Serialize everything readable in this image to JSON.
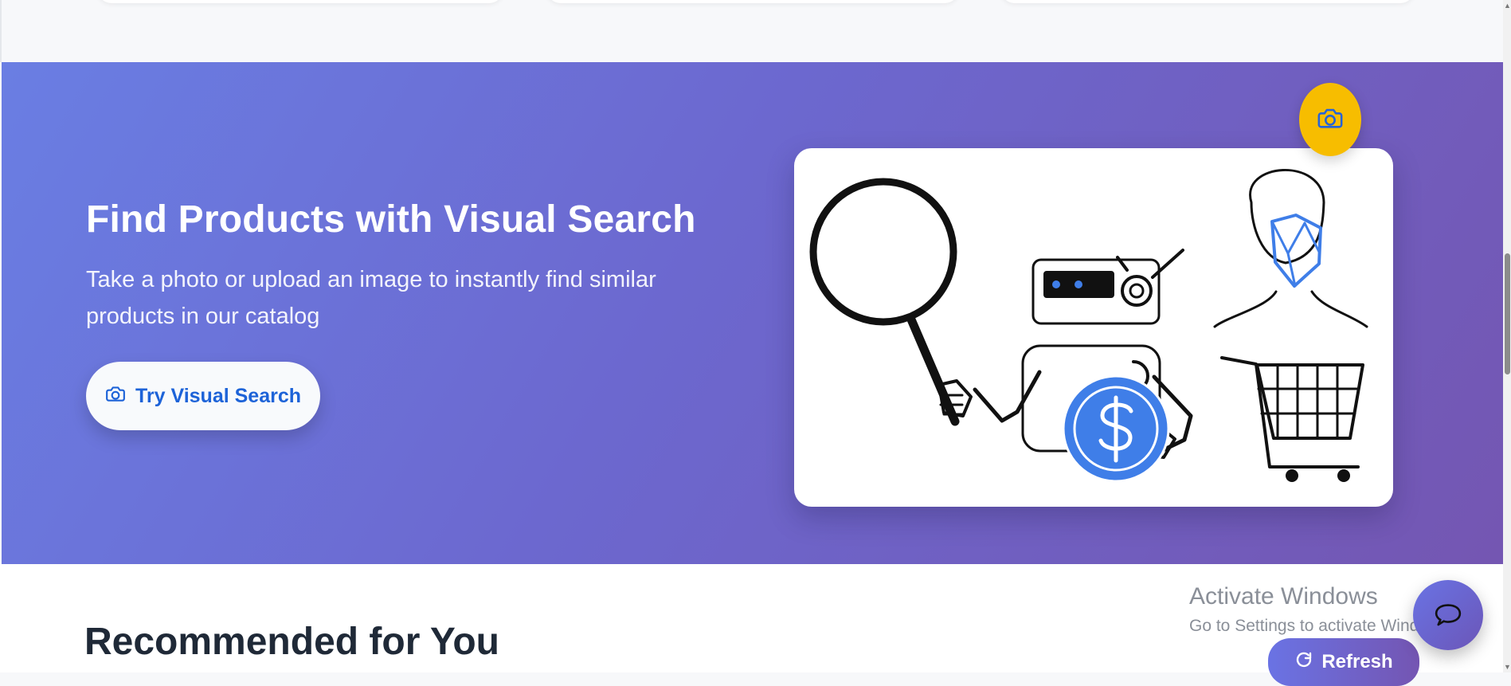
{
  "hero": {
    "title": "Find Products with Visual Search",
    "description": "Take a photo or upload an image to instantly find similar products in our catalog",
    "cta_label": "Try Visual Search",
    "illustration_alt": "Visual search illustration",
    "camera_icon": "camera-icon",
    "colors": {
      "gradient_start": "#6a7ee3",
      "gradient_end": "#7456b2",
      "cta_text": "#1d63d8",
      "badge": "#f7bd00",
      "accent": "#3f7ee8"
    }
  },
  "recommended": {
    "title": "Recommended for You"
  },
  "windows_activation": {
    "title": "Activate Windows",
    "subtitle": "Go to Settings to activate Windows."
  },
  "floating_actions": {
    "chat_icon": "chat-bubble-icon",
    "refresh_label": "Refresh",
    "refresh_icon": "refresh-icon"
  }
}
